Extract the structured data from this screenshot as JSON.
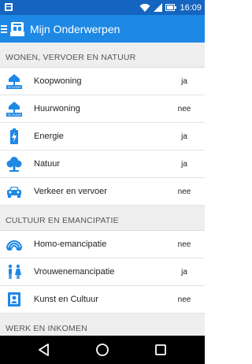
{
  "status_bar": {
    "time": "16:09",
    "colors": {
      "bar": "#1565c0"
    }
  },
  "app_bar": {
    "title": "Mijn Onderwerpen",
    "menu_icon": "hamburger-icon",
    "logo_icon": "topics-logo-icon",
    "color": "#1e88e5"
  },
  "sections": [
    {
      "header": "WONEN, VERVOER EN NATUUR",
      "items": [
        {
          "label": "Koopwoning",
          "value": "ja",
          "icon": "house-for-sale-icon"
        },
        {
          "label": "Huurwoning",
          "value": "nee",
          "icon": "house-for-rent-icon"
        },
        {
          "label": "Energie",
          "value": "ja",
          "icon": "battery-icon"
        },
        {
          "label": "Natuur",
          "value": "ja",
          "icon": "tree-icon"
        },
        {
          "label": "Verkeer en vervoer",
          "value": "nee",
          "icon": "car-icon"
        }
      ]
    },
    {
      "header": "CULTUUR EN EMANCIPATIE",
      "items": [
        {
          "label": "Homo-emancipatie",
          "value": "nee",
          "icon": "rainbow-icon"
        },
        {
          "label": "Vrouwenemancipatie",
          "value": "ja",
          "icon": "man-woman-icon"
        },
        {
          "label": "Kunst en Cultuur",
          "value": "nee",
          "icon": "framed-art-icon"
        }
      ]
    },
    {
      "header": "WERK EN INKOMEN",
      "items": []
    }
  ],
  "icon_texts": {
    "for_sale": "TE KOOP",
    "for_rent": "TE HUUR"
  },
  "nav_bar": {
    "back_icon": "back-triangle-icon",
    "home_icon": "home-circle-icon",
    "recents_icon": "recents-square-icon"
  }
}
